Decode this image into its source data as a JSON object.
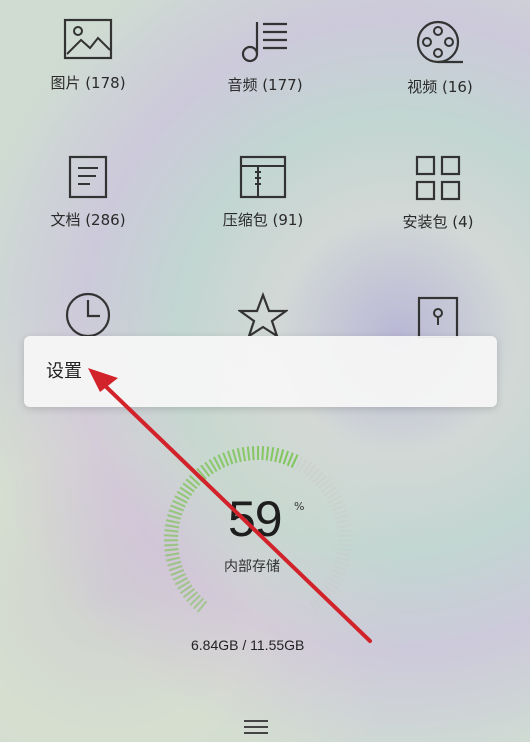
{
  "categories": [
    {
      "icon": "image-icon",
      "label": "图片 (178)"
    },
    {
      "icon": "music-icon",
      "label": "音频 (177)"
    },
    {
      "icon": "video-reel-icon",
      "label": "视频 (16)"
    },
    {
      "icon": "document-icon",
      "label": "文档 (286)"
    },
    {
      "icon": "archive-icon",
      "label": "压缩包 (91)"
    },
    {
      "icon": "apps-grid-icon",
      "label": "安装包 (4)"
    },
    {
      "icon": "clock-icon",
      "label": ""
    },
    {
      "icon": "star-icon",
      "label": ""
    },
    {
      "icon": "lock-file-icon",
      "label": ""
    }
  ],
  "popup": {
    "item_label": "设置"
  },
  "storage": {
    "percent": "59",
    "percent_symbol": "%",
    "label": "内部存储",
    "size_text": "6.84GB / 11.55GB",
    "used_fraction": 0.59,
    "accent_color": "#6bbf3a"
  },
  "annotation": {
    "arrow_color": "#d2222a"
  }
}
